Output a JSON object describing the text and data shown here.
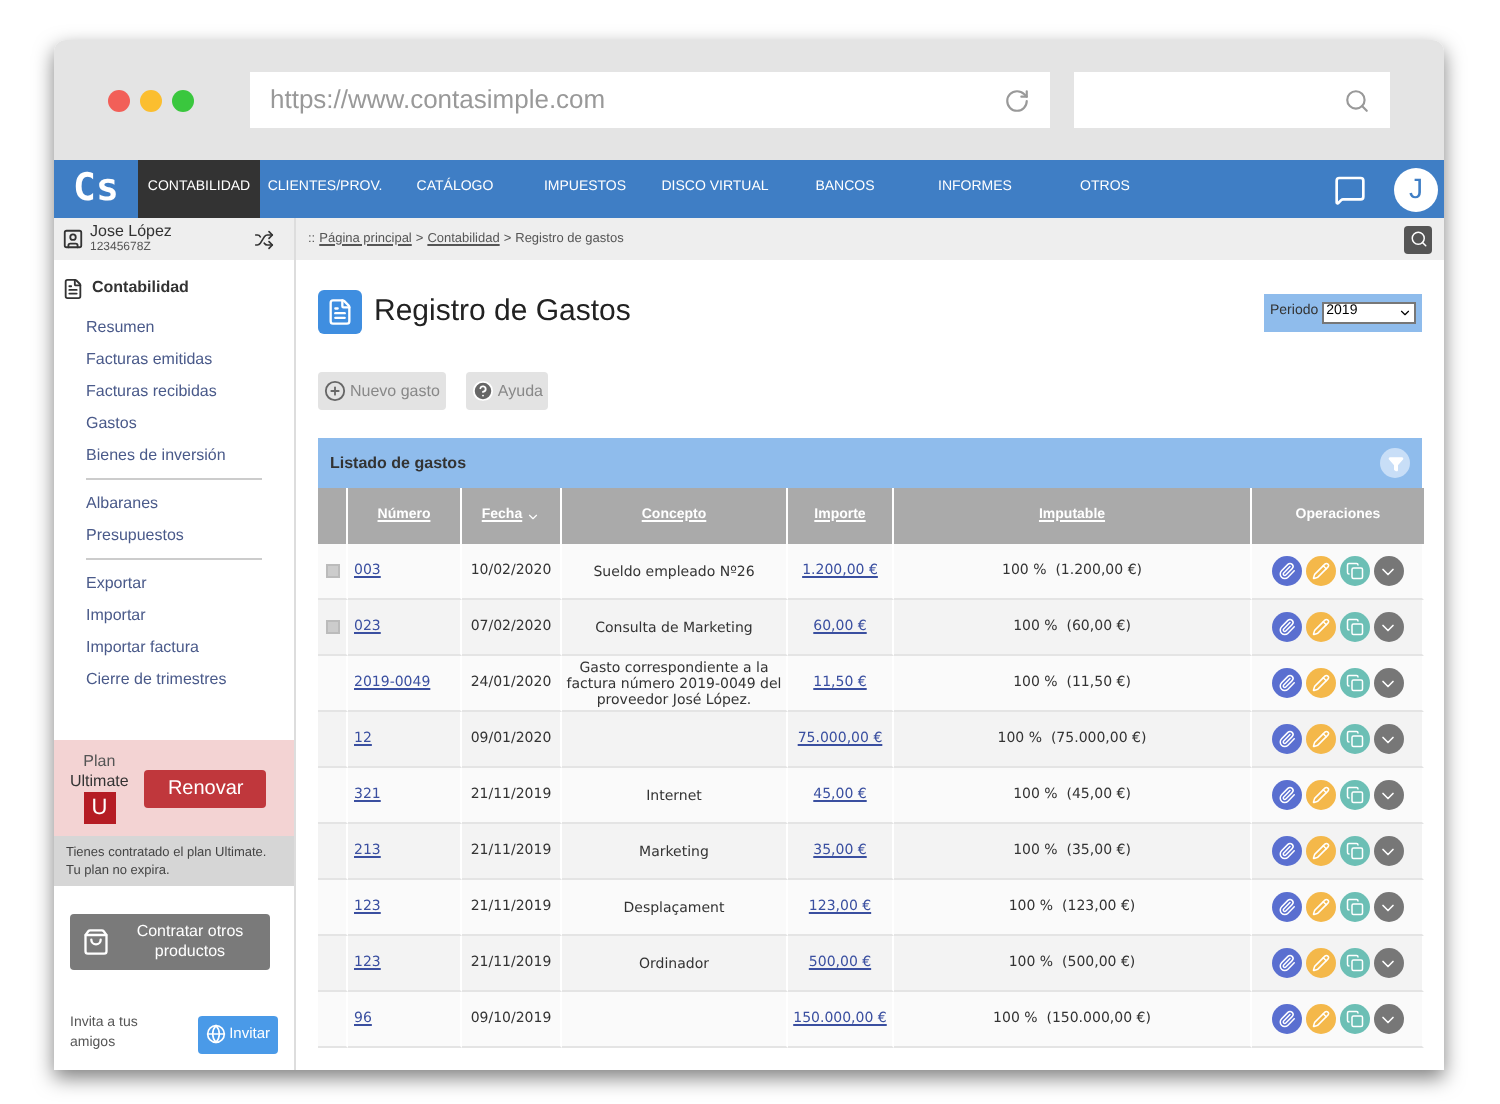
{
  "browser": {
    "url": "https://www.contasimple.com"
  },
  "nav": {
    "logo": "Cs",
    "items": [
      {
        "label": "CONTABILIDAD",
        "selected": true
      },
      {
        "label": "CLIENTES/PROV.",
        "selected": false
      },
      {
        "label": "CATÁLOGO",
        "selected": false
      },
      {
        "label": "IMPUESTOS",
        "selected": false
      },
      {
        "label": "DISCO VIRTUAL",
        "selected": false
      },
      {
        "label": "BANCOS",
        "selected": false
      },
      {
        "label": "INFORMES",
        "selected": false
      },
      {
        "label": "OTROS",
        "selected": false
      }
    ],
    "avatar_letter": "J"
  },
  "user": {
    "name": "Jose López",
    "id": "12345678Z"
  },
  "breadcrumb": {
    "prefix": "::",
    "separator": ">",
    "links": [
      "Página principal",
      "Contabilidad"
    ],
    "current": "Registro de gastos"
  },
  "sidebar": {
    "section": "Contabilidad",
    "groups": [
      [
        "Resumen",
        "Facturas emitidas",
        "Facturas recibidas",
        "Gastos",
        "Bienes de inversión"
      ],
      [
        "Albaranes",
        "Presupuestos"
      ],
      [
        "Exportar",
        "Importar",
        "Importar factura",
        "Cierre de trimestres"
      ]
    ]
  },
  "plan": {
    "label": "Plan",
    "name": "Ultimate",
    "letter": "U",
    "renew_button": "Renovar",
    "note": "Tienes contratado el plan Ultimate. Tu plan no expira."
  },
  "products_button": "Contratar otros productos",
  "invite": {
    "text": "Invita a tus amigos",
    "button": "Invitar"
  },
  "page": {
    "title": "Registro de Gastos",
    "period_label": "Periodo",
    "period_value": "2019"
  },
  "actions": [
    "Nuevo gasto",
    "Ayuda"
  ],
  "table": {
    "title": "Listado de gastos",
    "columns": [
      "Número",
      "Fecha",
      "Concepto",
      "Importe",
      "Imputable",
      "Operaciones"
    ],
    "rows": [
      {
        "selectable": true,
        "numero": "003",
        "fecha": "10/02/2020",
        "concepto": "Sueldo empleado Nº26",
        "importe": "1.200,00 €",
        "imputable": "100 %  (1.200,00 €)"
      },
      {
        "selectable": true,
        "numero": "023",
        "fecha": "07/02/2020",
        "concepto": "Consulta de Marketing",
        "importe": "60,00 €",
        "imputable": "100 %  (60,00 €)"
      },
      {
        "selectable": false,
        "numero": "2019-0049",
        "fecha": "24/01/2020",
        "concepto": "Gasto correspondiente a la factura número 2019-0049 del proveedor José López.",
        "importe": "11,50 €",
        "imputable": "100 %  (11,50 €)"
      },
      {
        "selectable": false,
        "numero": "12",
        "fecha": "09/01/2020",
        "importe": "75.000,00 €",
        "imputable": "100 %  (75.000,00 €)"
      },
      {
        "selectable": false,
        "numero": "321",
        "fecha": "21/11/2019",
        "concepto": "Internet",
        "importe": "45,00 €",
        "imputable": "100 %  (45,00 €)"
      },
      {
        "selectable": false,
        "numero": "213",
        "fecha": "21/11/2019",
        "concepto": "Marketing",
        "importe": "35,00 €",
        "imputable": "100 %  (35,00 €)"
      },
      {
        "selectable": false,
        "numero": "123",
        "fecha": "21/11/2019",
        "concepto": "Desplaçament",
        "importe": "123,00 €",
        "imputable": "100 %  (123,00 €)"
      },
      {
        "selectable": false,
        "numero": "123",
        "fecha": "21/11/2019",
        "concepto": "Ordinador",
        "importe": "500,00 €",
        "imputable": "100 %  (500,00 €)"
      },
      {
        "selectable": false,
        "numero": "96",
        "fecha": "09/10/2019",
        "importe": "150.000,00 €",
        "imputable": "100 %  (150.000,00 €)"
      }
    ]
  }
}
